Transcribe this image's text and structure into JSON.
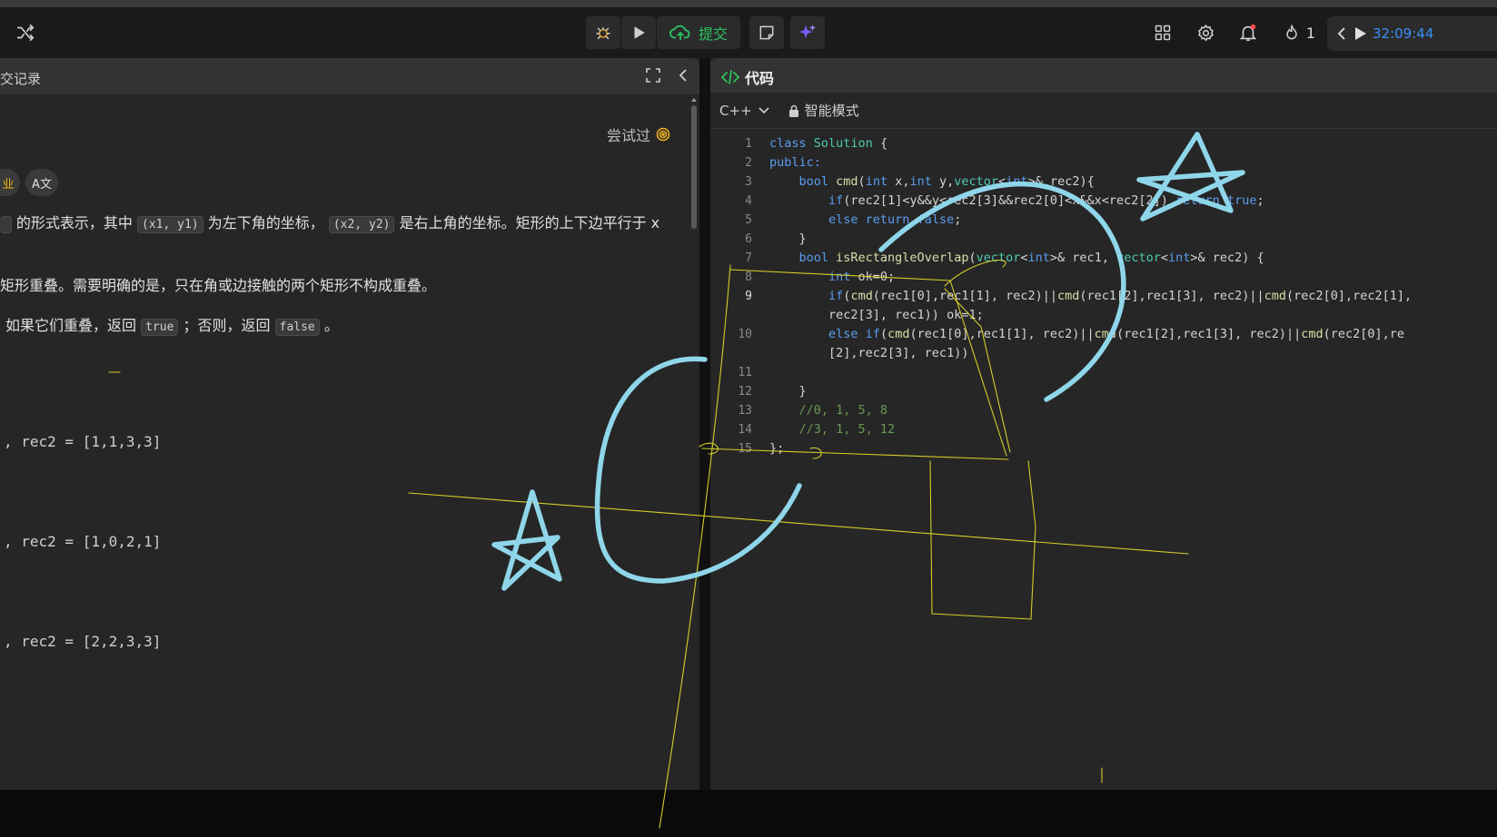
{
  "toolbar": {
    "submit_label": "提交",
    "streak_count": "1",
    "timer": "32:09:44",
    "icons": [
      "shuffle-icon",
      "debug-icon",
      "run-icon",
      "cloud-upload-icon",
      "note-icon",
      "sparkle-icon",
      "layout-icon",
      "settings-icon",
      "bell-icon",
      "flame-icon",
      "chevron-left-icon",
      "play-icon"
    ],
    "colors": {
      "submit": "#2ec25e",
      "timer": "#3a8ff7",
      "sparkle": "#7b5cff"
    }
  },
  "left": {
    "tab_label": "交记录",
    "tried_label": "尝试过",
    "chip_label": "业",
    "translate_label": "A文",
    "desc": {
      "l1a": "的形式表示，其中",
      "l1_code1": "(x1, y1)",
      "l1b": "为左下角的坐标，",
      "l1_code2": "(x2, y2)",
      "l1c": "是右上角的坐标。矩形的上下边平行于 x",
      "l2": "矩形重叠。需要明确的是，只在角或边接触的两个矩形不构成重叠。",
      "l3a": "如果它们重叠，返回",
      "l3_code1": "true",
      "l3b": "；否则，返回",
      "l3_code2": "false",
      "l3c": "。"
    },
    "examples": [
      ", rec2 = [1,1,3,3]",
      ", rec2 = [1,0,2,1]",
      ", rec2 = [2,2,3,3]"
    ]
  },
  "right": {
    "tab_label": "代码",
    "language": "C++",
    "mode_label": "智能模式",
    "line_numbers": [
      "1",
      "2",
      "3",
      "4",
      "5",
      "6",
      "7",
      "8",
      "9",
      "",
      "10",
      "",
      "11",
      "12",
      "13",
      "14",
      "15"
    ]
  }
}
